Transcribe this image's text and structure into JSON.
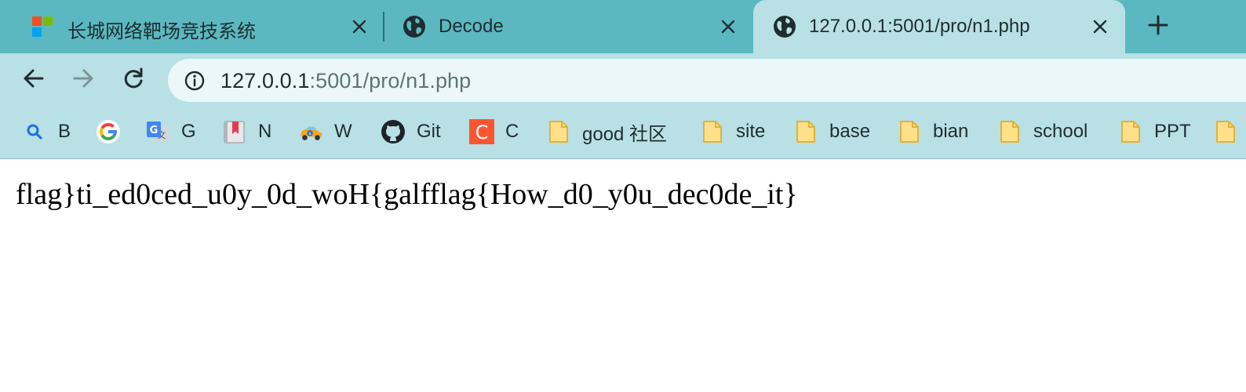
{
  "browser": {
    "tabs": [
      {
        "title": "长城网络靶场竞技系统",
        "favicon": "windows-squares-icon",
        "active": false
      },
      {
        "title": "Decode",
        "favicon": "globe-icon",
        "active": false
      },
      {
        "title": "127.0.0.1:5001/pro/n1.php",
        "favicon": "globe-icon",
        "active": true
      }
    ],
    "new_tab_icon": "plus-icon",
    "tab_close_icon": "close-icon"
  },
  "toolbar": {
    "back_icon": "arrow-left-icon",
    "forward_icon": "arrow-right-icon",
    "reload_icon": "reload-icon",
    "site_info_icon": "info-circle-icon",
    "url_host": "127.0.0.1",
    "url_rest": ":5001/pro/n1.php"
  },
  "bookmarks": [
    {
      "label": "B",
      "icon": "search-icon"
    },
    {
      "label": "",
      "icon": "google-icon"
    },
    {
      "label": "G",
      "icon": "translate-icon"
    },
    {
      "label": "N",
      "icon": "bookmark-book-icon"
    },
    {
      "label": "W",
      "icon": "car-icon"
    },
    {
      "label": "Git",
      "icon": "github-icon"
    },
    {
      "label": "C",
      "icon": "csdn-c-icon"
    },
    {
      "label": "good 社区",
      "icon": "folder-icon"
    },
    {
      "label": "site",
      "icon": "folder-icon"
    },
    {
      "label": "base",
      "icon": "folder-icon"
    },
    {
      "label": "bian",
      "icon": "folder-icon"
    },
    {
      "label": "school",
      "icon": "folder-icon"
    },
    {
      "label": "PPT",
      "icon": "folder-icon"
    },
    {
      "label": "",
      "icon": "folder-icon"
    }
  ],
  "colors": {
    "tabstrip_bg": "#5bb8c1",
    "toolbar_bg": "#b8e0e5",
    "omnibox_bg": "#ebf7f8",
    "folder_fill": "#ffe08a",
    "folder_stroke": "#e0b33a"
  },
  "page": {
    "text": "flag}ti_ed0ced_u0y_0d_woH{galfflag{How_d0_y0u_dec0de_it}"
  }
}
